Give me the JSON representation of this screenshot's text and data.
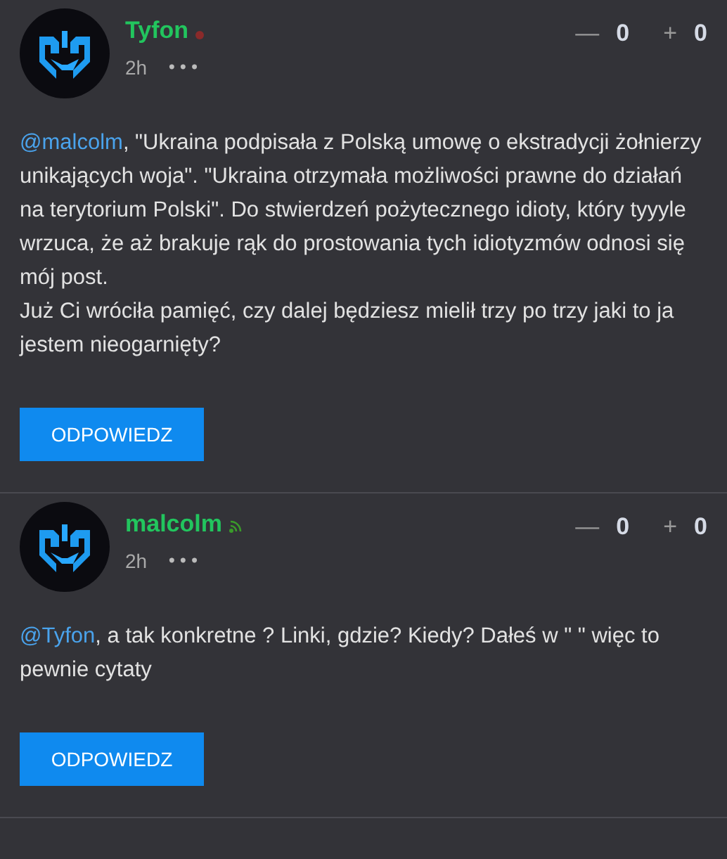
{
  "posts": [
    {
      "author": "Tyfon",
      "online": false,
      "time": "2h",
      "menu": "•••",
      "votes": {
        "down_icon": "—",
        "down": "0",
        "up_icon": "+",
        "up": "0"
      },
      "mention": "@malcolm",
      "paragraphs": [
        ", \"Ukraina podpisała z Polską umowę o ekstradycji żołnierzy unikających woja\". \"Ukraina otrzymała możliwości prawne do działań na terytorium Polski\". Do stwierdzeń pożytecznego idioty, który tyyyle wrzuca, że aż brakuje rąk do prostowania tych idiotyzmów odnosi się mój post.",
        "Już Ci wróciła pamięć, czy dalej będziesz mielił trzy po trzy jaki to ja jestem nieogarnięty?"
      ],
      "reply": "ODPOWIEDZ"
    },
    {
      "author": "malcolm",
      "online": true,
      "time": "2h",
      "menu": "•••",
      "votes": {
        "down_icon": "—",
        "down": "0",
        "up_icon": "+",
        "up": "0"
      },
      "mention": "@Tyfon",
      "paragraphs": [
        ", a tak konkretne ? Linki, gdzie? Kiedy? Dałeś w \" \" więc to pewnie cytaty"
      ],
      "reply": "ODPOWIEDZ"
    }
  ]
}
